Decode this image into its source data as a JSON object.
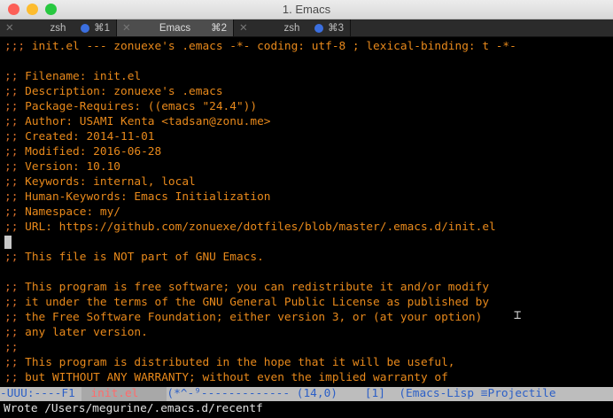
{
  "window": {
    "title": "1. Emacs"
  },
  "tabs": [
    {
      "label": "zsh",
      "shortcut": "⌘1",
      "active": false
    },
    {
      "label": "Emacs",
      "shortcut": "⌘2",
      "active": true
    },
    {
      "label": "zsh",
      "shortcut": "⌘3",
      "active": false
    }
  ],
  "editor": {
    "lines": [
      {
        "p": ";;;",
        "t": " init.el --- zonuexe's .emacs -*- coding: utf-8 ; lexical-binding: t -*-"
      },
      {
        "p": "",
        "t": ""
      },
      {
        "p": ";;",
        "t": " Filename: init.el"
      },
      {
        "p": ";;",
        "t": " Description: zonuexe's .emacs"
      },
      {
        "p": ";;",
        "t": " Package-Requires: ((emacs \"24.4\"))"
      },
      {
        "p": ";;",
        "t": " Author: USAMI Kenta <tadsan@zonu.me>"
      },
      {
        "p": ";;",
        "t": " Created: 2014-11-01"
      },
      {
        "p": ";;",
        "t": " Modified: 2016-06-28"
      },
      {
        "p": ";;",
        "t": " Version: 10.10"
      },
      {
        "p": ";;",
        "t": " Keywords: internal, local"
      },
      {
        "p": ";;",
        "t": " Human-Keywords: Emacs Initialization"
      },
      {
        "p": ";;",
        "t": " Namespace: my/"
      },
      {
        "p": ";;",
        "t": " URL: https://github.com/zonuexe/dotfiles/blob/master/.emacs.d/init.el"
      },
      {
        "p": "",
        "t": "",
        "cursor": true
      },
      {
        "p": ";;",
        "t": " This file is NOT part of GNU Emacs."
      },
      {
        "p": "",
        "t": ""
      },
      {
        "p": ";;",
        "t": " This program is free software; you can redistribute it and/or modify"
      },
      {
        "p": ";;",
        "t": " it under the terms of the GNU General Public License as published by"
      },
      {
        "p": ";;",
        "t": " the Free Software Foundation; either version 3, or (at your option)"
      },
      {
        "p": ";;",
        "t": " any later version."
      },
      {
        "p": ";;",
        "t": ""
      },
      {
        "p": ";;",
        "t": " This program is distributed in the hope that it will be useful,"
      },
      {
        "p": ";;",
        "t": " but WITHOUT ANY WARRANTY; without even the implied warranty of"
      }
    ]
  },
  "modeline": {
    "left": "-UUU:----F1 ",
    "buffer": "init.el",
    "right": "(*^-⁹------------- (14,0)    [1]  (Emacs-Lisp ≡Projectile"
  },
  "minibuffer": "Wrote /Users/megurine/.emacs.d/recentf",
  "colors": {
    "text": "#e8891b",
    "modeline": "#bdbdbd",
    "buffer_name": "#ff6b6b"
  }
}
